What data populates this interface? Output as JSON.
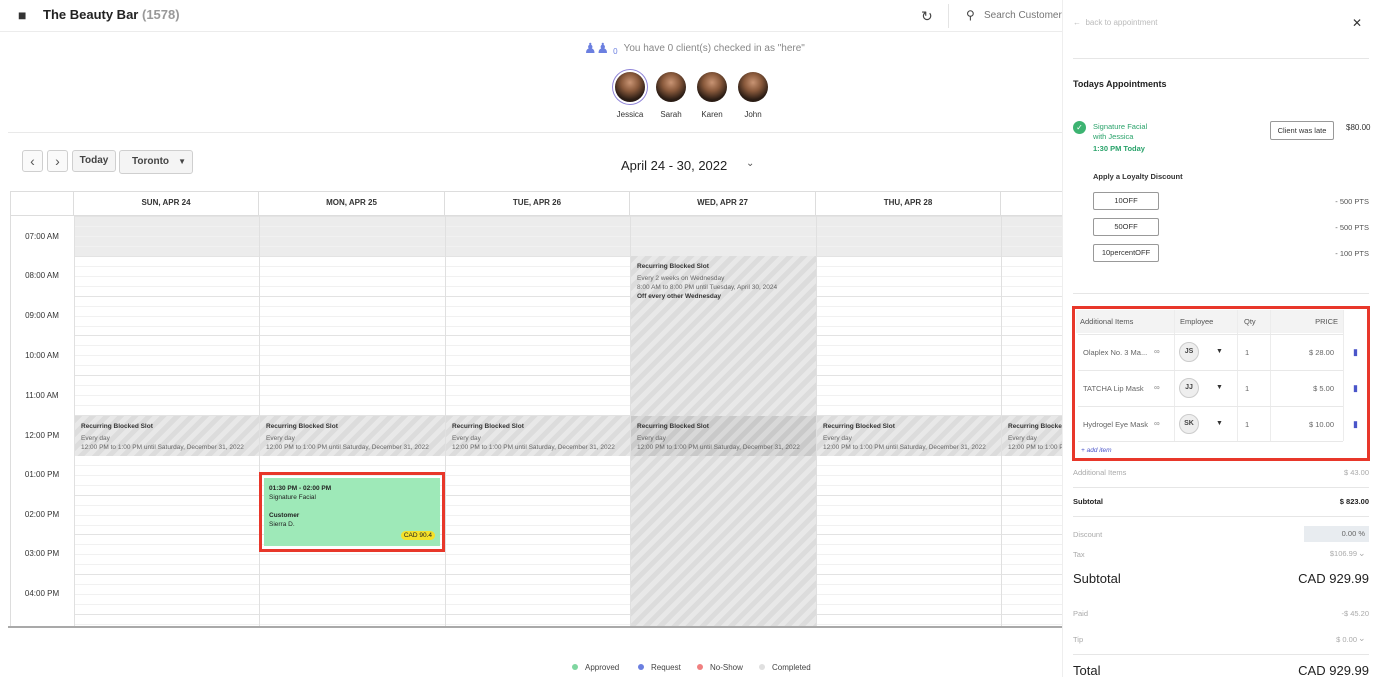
{
  "header": {
    "brand_name": "The Beauty Bar",
    "brand_count": "(1578)",
    "search_placeholder": "Search Customers"
  },
  "checkin": {
    "count": "0",
    "message": "You have 0 client(s) checked in as \"here\"",
    "staff": [
      {
        "name": "Jessica",
        "selected": true
      },
      {
        "name": "Sarah",
        "selected": false
      },
      {
        "name": "Karen",
        "selected": false
      },
      {
        "name": "John",
        "selected": false
      }
    ]
  },
  "calendar": {
    "today_label": "Today",
    "timezone": "Toronto",
    "range": "April 24 - 30, 2022",
    "days": [
      "SUN, APR 24",
      "MON, APR 25",
      "TUE, APR 26",
      "WED, APR 27",
      "THU, APR 28"
    ],
    "times": [
      "07:00 AM",
      "08:00 AM",
      "09:00 AM",
      "10:00 AM",
      "11:00 AM",
      "12:00 PM",
      "01:00 PM",
      "02:00 PM",
      "03:00 PM",
      "04:00 PM"
    ],
    "blocked_noon": {
      "title": "Recurring Blocked Slot",
      "line1": "Every day",
      "line2": "12:00 PM to 1:00 PM until Saturday, December 31, 2022",
      "partial_title": "Recurring Blocke",
      "partial_line1": "Every day",
      "partial_line2": "12:00 PM to 1:00 PM"
    },
    "blocked_wed": {
      "title": "Recurring Blocked Slot",
      "line1": "Every 2 weeks on Wednesday",
      "line2": "8:00 AM to 8:00 PM until Tuesday, April 30, 2024",
      "note": "Off every other Wednesday"
    },
    "appointment": {
      "time": "01:30 PM - 02:00 PM",
      "service": "Signature Facial",
      "customer_label": "Customer",
      "customer_name": "Sierra D.",
      "price": "CAD 90.4"
    }
  },
  "legend": [
    {
      "label": "Approved",
      "color": "#7fd6a0"
    },
    {
      "label": "Request",
      "color": "#6b7fe0"
    },
    {
      "label": "No-Show",
      "color": "#f08080"
    },
    {
      "label": "Completed",
      "color": "#e0e0e0"
    }
  ],
  "panel": {
    "back_label": "back to appointment",
    "todays_title": "Todays Appointments",
    "service": {
      "name": "Signature Facial",
      "with": "with Jessica",
      "time": "1:30 PM Today",
      "late_label": "Client was late",
      "price": "$80.00"
    },
    "loyalty_title": "Apply a Loyalty Discount",
    "discounts": [
      {
        "code": "10OFF",
        "pts": "- 500 PTS"
      },
      {
        "code": "50OFF",
        "pts": "- 500 PTS"
      },
      {
        "code": "10percentOFF",
        "pts": "- 100 PTS"
      }
    ],
    "additional": {
      "headers": {
        "item": "Additional Items",
        "employee": "Employee",
        "qty": "Qty",
        "price": "PRICE"
      },
      "rows": [
        {
          "item": "Olaplex No. 3 Ma...",
          "emp": "JS",
          "qty": "1",
          "price": "$ 28.00"
        },
        {
          "item": "TATCHA Lip Mask",
          "emp": "JJ",
          "qty": "1",
          "price": "$ 5.00"
        },
        {
          "item": "Hydrogel Eye Mask",
          "emp": "SK",
          "qty": "1",
          "price": "$ 10.00"
        }
      ],
      "add_label": "+ add item"
    },
    "summary": {
      "additional_label": "Additional Items",
      "additional_value": "$ 43.00",
      "subtotal_label": "Subtotal",
      "subtotal_value": "$ 823.00",
      "discount_label": "Discount",
      "discount_value": "0.00 %",
      "tax_label": "Tax",
      "tax_value": "$106.99",
      "subtotal2_label": "Subtotal",
      "subtotal2_value": "CAD 929.99",
      "paid_label": "Paid",
      "paid_value": "-$ 45.20",
      "tip_label": "Tip",
      "tip_value": "$ 0.00",
      "total_label": "Total",
      "total_value": "CAD 929.99"
    }
  }
}
